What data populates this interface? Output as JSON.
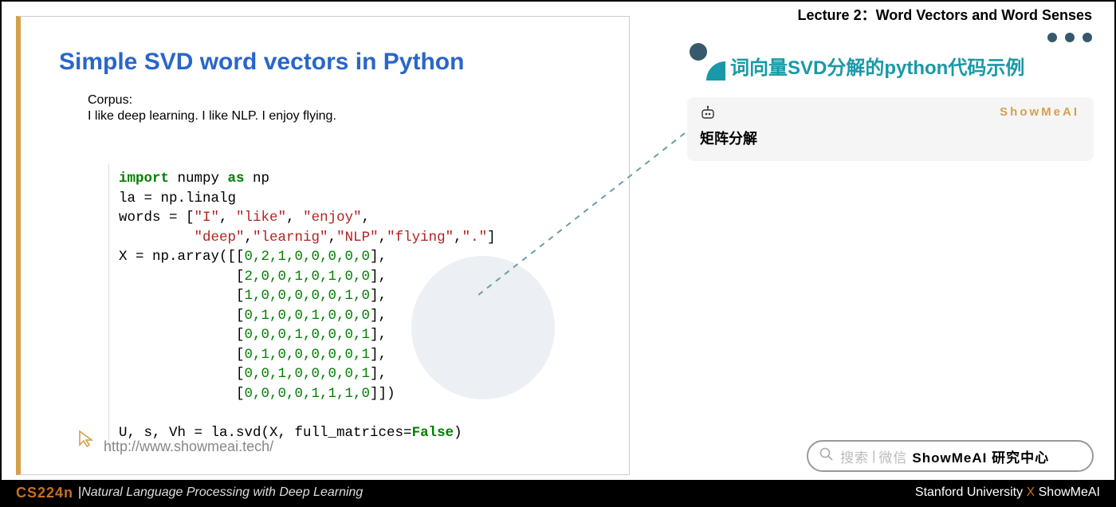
{
  "lecture_header": "Lecture 2：Word Vectors and Word Senses",
  "slide": {
    "title": "Simple SVD word vectors in Python",
    "corpus_label": "Corpus:",
    "corpus_text": "I like deep learning. I like NLP. I enjoy flying.",
    "url": "http://www.showmeai.tech/"
  },
  "code": {
    "kw_import": "import",
    "mod": " numpy ",
    "kw_as": "as",
    "alias": " np",
    "l2": "la = np.linalg",
    "l3a": "words = [",
    "s1": "\"I\"",
    "c": ", ",
    "s2": "\"like\"",
    "s3": "\"enjoy\"",
    "comma_end": ",",
    "l4pad": "         ",
    "s4": "\"deep\"",
    "s5": "\"learnig\"",
    "s6": "\"NLP\"",
    "s7": "\"flying\"",
    "s8": "\".\"",
    "close": "]",
    "l5": "X = np.array([[",
    "r1": "0,2,1,0,0,0,0,0",
    "end": "],",
    "pad": "              [",
    "r2": "2,0,0,1,0,1,0,0",
    "r3": "1,0,0,0,0,0,1,0",
    "r4": "0,1,0,0,1,0,0,0",
    "r5": "0,0,0,1,0,0,0,1",
    "r6": "0,1,0,0,0,0,0,1",
    "r7": "0,0,1,0,0,0,0,1",
    "r8": "0,0,0,0,1,1,1,0",
    "last": "]])",
    "l14a": "U, s, Vh = la.svd(X, full_matrices=",
    "false": "False",
    "l14b": ")"
  },
  "section_title": "词向量SVD分解的python代码示例",
  "card": {
    "brand": "ShowMeAI",
    "text": "矩阵分解"
  },
  "search": {
    "placeholder": "搜索",
    "channel": "微信",
    "target": "ShowMeAI 研究中心"
  },
  "footer": {
    "course": "CS224n",
    "bar": " | ",
    "sub": "Natural Language Processing with Deep Learning",
    "univ": "Stanford University ",
    "x": "X",
    "brand": " ShowMeAI"
  }
}
